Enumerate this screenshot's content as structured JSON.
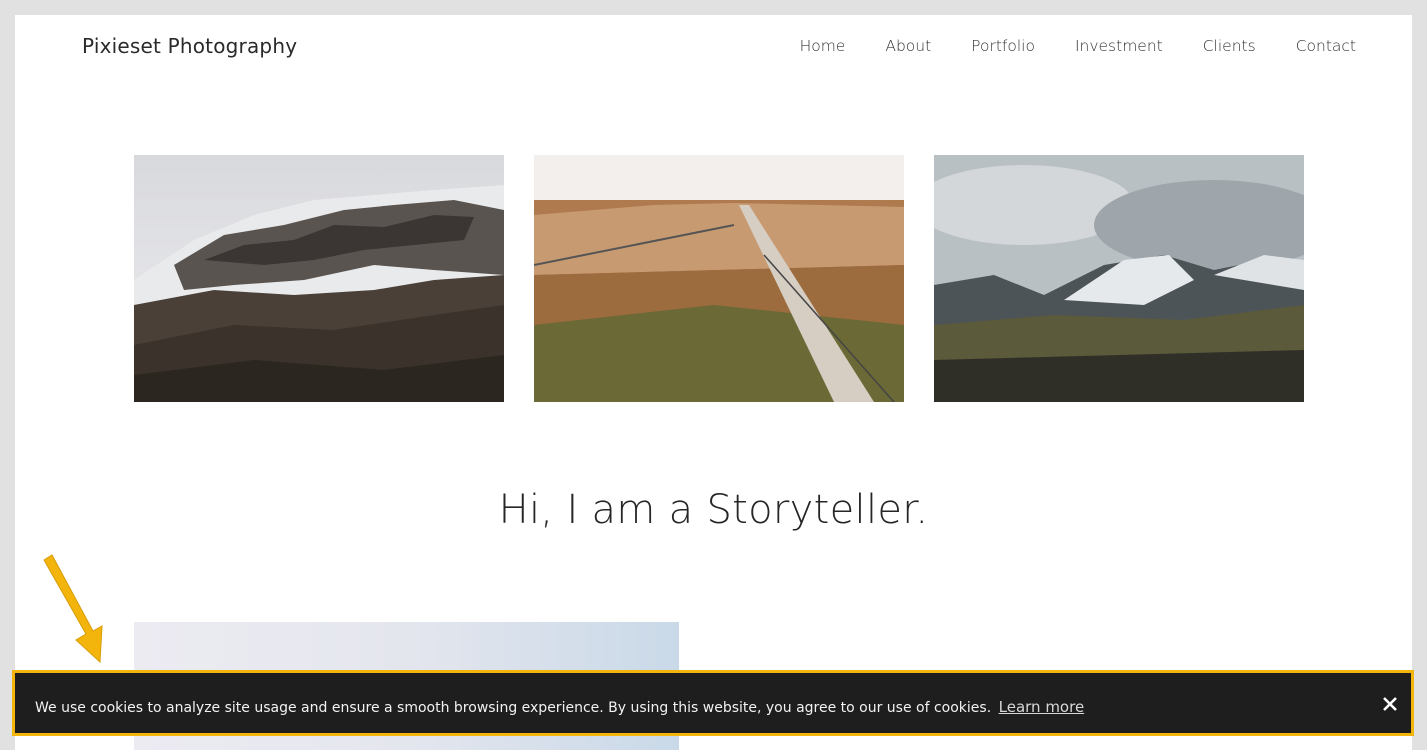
{
  "header": {
    "logo": "Pixieset Photography",
    "nav": [
      "Home",
      "About",
      "Portfolio",
      "Investment",
      "Clients",
      "Contact"
    ]
  },
  "gallery": {
    "images": [
      {
        "icon": "snowy-mountain-slope-image"
      },
      {
        "icon": "autumn-forest-road-image"
      },
      {
        "icon": "mountain-range-valley-image"
      }
    ]
  },
  "intro": {
    "headline": "Hi, I am a Storyteller."
  },
  "cookie_banner": {
    "message": "We use cookies to analyze site usage and ensure a smooth browsing experience. By using this website, you agree to our use of cookies.",
    "link": "Learn more",
    "close_icon": "close-icon",
    "highlight_color": "#f3b50c"
  }
}
